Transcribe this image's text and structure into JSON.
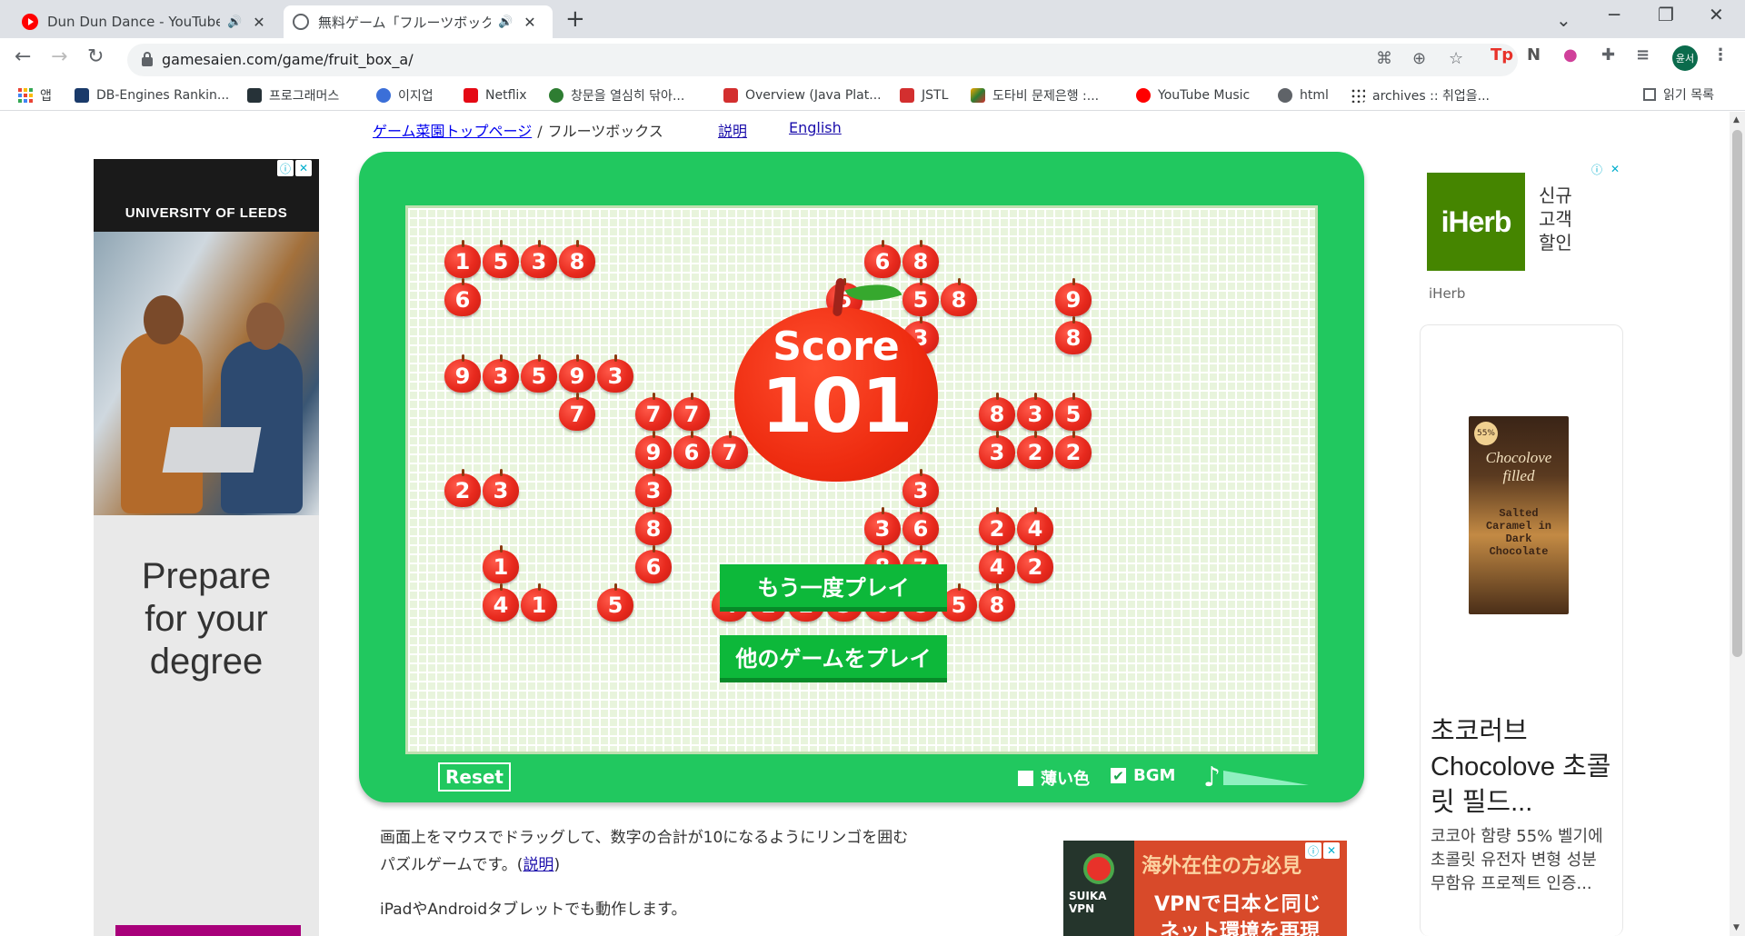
{
  "browser": {
    "tabs": [
      {
        "title": "Dun Dun Dance - YouTube",
        "favicon": "youtube-icon"
      },
      {
        "title": "無料ゲーム「フルーツボックス」",
        "favicon": "globe-icon"
      }
    ],
    "url": "gamesaien.com/game/fruit_box_a/",
    "profile_initials": "윤서",
    "bookmarks": [
      {
        "label": "앱"
      },
      {
        "label": "DB-Engines Rankin..."
      },
      {
        "label": "프로그래머스"
      },
      {
        "label": "이지업"
      },
      {
        "label": "Netflix"
      },
      {
        "label": "창문을 열심히 닦아..."
      },
      {
        "label": "Overview (Java Plat..."
      },
      {
        "label": "JSTL"
      },
      {
        "label": "도타비 문제은행 :..."
      },
      {
        "label": "YouTube Music"
      },
      {
        "label": "html"
      },
      {
        "label": "archives :: 취업을..."
      }
    ],
    "reading_list": "읽기 목록"
  },
  "page": {
    "breadcrumb_home": "ゲーム菜園トップページ",
    "breadcrumb_sep": "/",
    "breadcrumb_current": "フルーツボックス",
    "link_help": "説明",
    "link_english": "English"
  },
  "ad_left": {
    "brand": "UNIVERSITY OF LEEDS",
    "copy_lines": [
      "Prepare",
      "for your",
      "degree"
    ]
  },
  "game": {
    "score_label": "Score",
    "score_value": "101",
    "play_again": "もう一度プレイ",
    "other_games": "他のゲームをプレイ",
    "reset": "Reset",
    "option_light_color": "薄い色",
    "option_bgm": "BGM",
    "light_color_checked": false,
    "bgm_checked": true,
    "volume": 1.0,
    "apples": [
      {
        "col": 0,
        "row": 0,
        "n": "1"
      },
      {
        "col": 1,
        "row": 0,
        "n": "5"
      },
      {
        "col": 2,
        "row": 0,
        "n": "3"
      },
      {
        "col": 3,
        "row": 0,
        "n": "8"
      },
      {
        "col": 11,
        "row": 0,
        "n": "6"
      },
      {
        "col": 12,
        "row": 0,
        "n": "8"
      },
      {
        "col": 0,
        "row": 1,
        "n": "6"
      },
      {
        "col": 10,
        "row": 1,
        "n": "5"
      },
      {
        "col": 12,
        "row": 1,
        "n": "5"
      },
      {
        "col": 13,
        "row": 1,
        "n": "8"
      },
      {
        "col": 16,
        "row": 1,
        "n": "9"
      },
      {
        "col": 12,
        "row": 2,
        "n": "3"
      },
      {
        "col": 16,
        "row": 2,
        "n": "8"
      },
      {
        "col": 0,
        "row": 3,
        "n": "9"
      },
      {
        "col": 1,
        "row": 3,
        "n": "3"
      },
      {
        "col": 2,
        "row": 3,
        "n": "5"
      },
      {
        "col": 3,
        "row": 3,
        "n": "9"
      },
      {
        "col": 4,
        "row": 3,
        "n": "3"
      },
      {
        "col": 3,
        "row": 4,
        "n": "7"
      },
      {
        "col": 5,
        "row": 4,
        "n": "7"
      },
      {
        "col": 6,
        "row": 4,
        "n": "7"
      },
      {
        "col": 14,
        "row": 4,
        "n": "8"
      },
      {
        "col": 15,
        "row": 4,
        "n": "3"
      },
      {
        "col": 16,
        "row": 4,
        "n": "5"
      },
      {
        "col": 5,
        "row": 5,
        "n": "9"
      },
      {
        "col": 6,
        "row": 5,
        "n": "6"
      },
      {
        "col": 7,
        "row": 5,
        "n": "7"
      },
      {
        "col": 14,
        "row": 5,
        "n": "3"
      },
      {
        "col": 15,
        "row": 5,
        "n": "2"
      },
      {
        "col": 16,
        "row": 5,
        "n": "2"
      },
      {
        "col": 0,
        "row": 6,
        "n": "2"
      },
      {
        "col": 1,
        "row": 6,
        "n": "3"
      },
      {
        "col": 5,
        "row": 6,
        "n": "3"
      },
      {
        "col": 12,
        "row": 6,
        "n": "3"
      },
      {
        "col": 5,
        "row": 7,
        "n": "8"
      },
      {
        "col": 11,
        "row": 7,
        "n": "3"
      },
      {
        "col": 12,
        "row": 7,
        "n": "6"
      },
      {
        "col": 14,
        "row": 7,
        "n": "2"
      },
      {
        "col": 15,
        "row": 7,
        "n": "4"
      },
      {
        "col": 1,
        "row": 8,
        "n": "1"
      },
      {
        "col": 5,
        "row": 8,
        "n": "6"
      },
      {
        "col": 11,
        "row": 8,
        "n": "8"
      },
      {
        "col": 12,
        "row": 8,
        "n": "7"
      },
      {
        "col": 14,
        "row": 8,
        "n": "4"
      },
      {
        "col": 15,
        "row": 8,
        "n": "2"
      },
      {
        "col": 1,
        "row": 9,
        "n": "4"
      },
      {
        "col": 2,
        "row": 9,
        "n": "1"
      },
      {
        "col": 4,
        "row": 9,
        "n": "5"
      },
      {
        "col": 7,
        "row": 9,
        "n": "4"
      },
      {
        "col": 8,
        "row": 9,
        "n": "1"
      },
      {
        "col": 9,
        "row": 9,
        "n": "2"
      },
      {
        "col": 10,
        "row": 9,
        "n": "3"
      },
      {
        "col": 11,
        "row": 9,
        "n": "6"
      },
      {
        "col": 12,
        "row": 9,
        "n": "8"
      },
      {
        "col": 13,
        "row": 9,
        "n": "5"
      },
      {
        "col": 14,
        "row": 9,
        "n": "8"
      }
    ]
  },
  "description": {
    "text": "画面上をマウスでドラッグして、数字の合計が10になるようにリンゴを囲むパズルゲームです。(",
    "help_link": "説明",
    "text_end": ")",
    "tablet_note": "iPadやAndroidタブレットでも動作します。"
  },
  "ad_vpn": {
    "brand": "SUIKA VPN",
    "line1": "海外在住の方必見",
    "line2": "VPNで日本と同じ",
    "line3": "ネット環境を再現"
  },
  "ad_right": {
    "iherb_logo": "iHerb",
    "iherb_tagline": "신규 고객 할인",
    "iherb_name": "iHerb",
    "product_badge": "55%",
    "product_brand": "Chocolove filled",
    "product_flavor": "Salted Caramel in Dark Chocolate",
    "product_title": "초코러브 Chocolove 초콜릿 필드...",
    "product_desc": "코코아 함량 55% 벨기에 초콜릿 유전자 변형 성분 무함유 프로젝트 인증..."
  },
  "colors": {
    "frame_green": "#21c85f",
    "button_green": "#0db83a",
    "apple_red": "#e82a1e",
    "link_blue": "#1a0dab"
  }
}
